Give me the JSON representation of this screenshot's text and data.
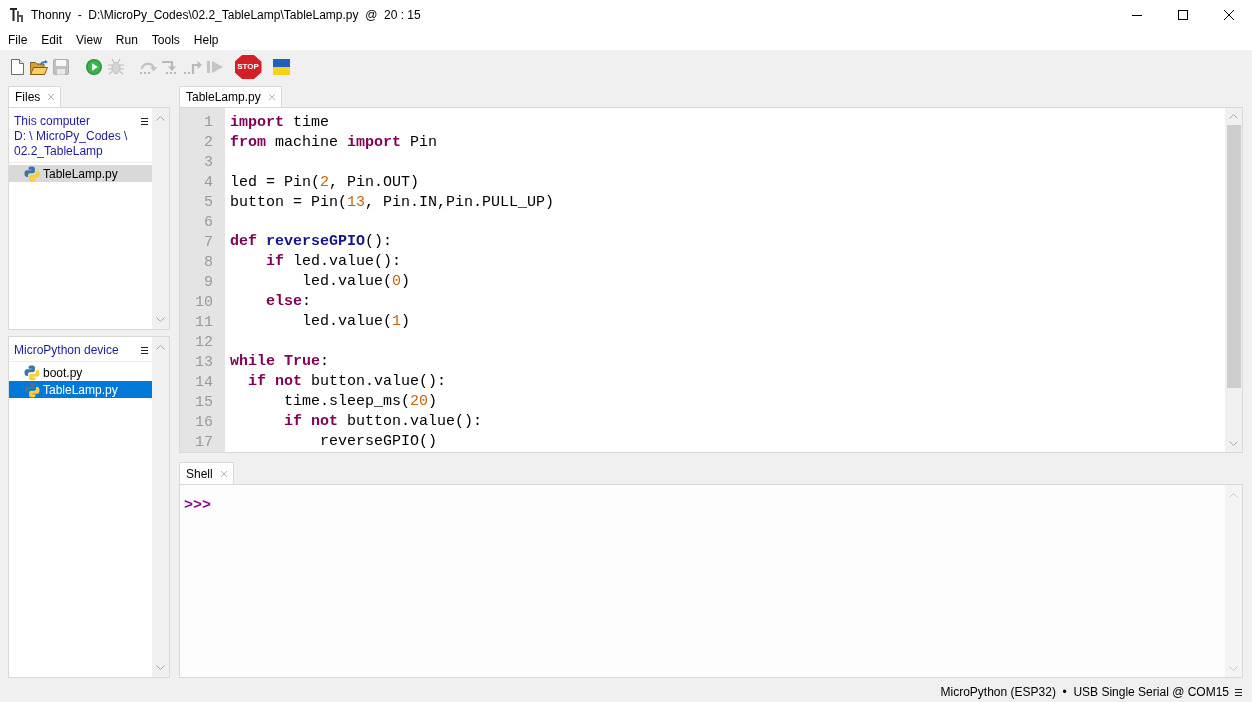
{
  "window": {
    "title": "Thonny  -  D:\\MicroPy_Codes\\02.2_TableLamp\\TableLamp.py  @  20 : 15"
  },
  "menu": [
    "File",
    "Edit",
    "View",
    "Run",
    "Tools",
    "Help"
  ],
  "toolbar": [
    {
      "buttons": [
        {
          "kind": "new",
          "disabled": false
        },
        {
          "kind": "open",
          "disabled": false
        },
        {
          "kind": "save",
          "disabled": true
        }
      ]
    },
    {
      "buttons": [
        {
          "kind": "run",
          "disabled": false
        },
        {
          "kind": "debug",
          "disabled": true
        }
      ]
    },
    {
      "buttons": [
        {
          "kind": "step_over",
          "disabled": true
        },
        {
          "kind": "step_into",
          "disabled": true
        },
        {
          "kind": "step_out",
          "disabled": true
        },
        {
          "kind": "resume",
          "disabled": true
        }
      ]
    },
    {
      "buttons": [
        {
          "kind": "stop",
          "label": "STOP",
          "disabled": false
        }
      ]
    },
    {
      "buttons": [
        {
          "kind": "flag",
          "disabled": false
        }
      ]
    }
  ],
  "files_view": {
    "tab": {
      "label": "Files",
      "selected": true
    },
    "panes": [
      {
        "location": [
          "This computer",
          "D: \\ MicroPy_Codes \\",
          "02.2_TableLamp"
        ],
        "focused": false,
        "items": [
          {
            "name": "TableLamp.py",
            "selected": true
          }
        ]
      },
      {
        "location": [
          "MicroPython device"
        ],
        "focused": true,
        "items": [
          {
            "name": "boot.py",
            "selected": false
          },
          {
            "name": "TableLamp.py",
            "selected": true
          }
        ]
      }
    ]
  },
  "editor": {
    "tabs": [
      {
        "label": "TableLamp.py",
        "selected": true
      }
    ],
    "lines": [
      {
        "number": "1",
        "tokens": [
          {
            "kind": "keyword",
            "text": "import"
          },
          {
            "kind": "plain",
            "text": " time"
          }
        ]
      },
      {
        "number": "2",
        "tokens": [
          {
            "kind": "keyword",
            "text": "from"
          },
          {
            "kind": "plain",
            "text": " machine "
          },
          {
            "kind": "keyword",
            "text": "import"
          },
          {
            "kind": "plain",
            "text": " Pin"
          }
        ]
      },
      {
        "number": "3"
      },
      {
        "number": "4",
        "tokens": [
          {
            "kind": "plain",
            "text": "led = Pin("
          },
          {
            "kind": "number",
            "text": "2"
          },
          {
            "kind": "plain",
            "text": ", Pin.OUT)"
          }
        ]
      },
      {
        "number": "5",
        "tokens": [
          {
            "kind": "plain",
            "text": "button = Pin("
          },
          {
            "kind": "number",
            "text": "13"
          },
          {
            "kind": "plain",
            "text": ", Pin.IN,Pin.PULL_UP)"
          }
        ]
      },
      {
        "number": "6"
      },
      {
        "number": "7",
        "tokens": [
          {
            "kind": "keyword",
            "text": "def"
          },
          {
            "kind": "function",
            "text": " reverseGPIO"
          },
          {
            "kind": "plain",
            "text": "():"
          }
        ]
      },
      {
        "number": "8",
        "tokens": [
          {
            "kind": "keyword",
            "text": "    if"
          },
          {
            "kind": "plain",
            "text": " led.value():"
          }
        ]
      },
      {
        "number": "9",
        "tokens": [
          {
            "kind": "plain",
            "text": "        led.value("
          },
          {
            "kind": "number",
            "text": "0"
          },
          {
            "kind": "plain",
            "text": ")"
          }
        ]
      },
      {
        "number": "10",
        "tokens": [
          {
            "kind": "keyword",
            "text": "    else"
          },
          {
            "kind": "plain",
            "text": ":"
          }
        ]
      },
      {
        "number": "11",
        "tokens": [
          {
            "kind": "plain",
            "text": "        led.value("
          },
          {
            "kind": "number",
            "text": "1"
          },
          {
            "kind": "plain",
            "text": ")"
          }
        ]
      },
      {
        "number": "12"
      },
      {
        "number": "13",
        "tokens": [
          {
            "kind": "keyword",
            "text": "while"
          },
          {
            "kind": "keyword",
            "text": " True"
          },
          {
            "kind": "plain",
            "text": ":"
          }
        ]
      },
      {
        "number": "14",
        "tokens": [
          {
            "kind": "keyword",
            "text": "  if"
          },
          {
            "kind": "keyword",
            "text": " not"
          },
          {
            "kind": "plain",
            "text": " button.value():"
          }
        ]
      },
      {
        "number": "15",
        "tokens": [
          {
            "kind": "plain",
            "text": "      time.sleep_ms("
          },
          {
            "kind": "number",
            "text": "20"
          },
          {
            "kind": "plain",
            "text": ")"
          }
        ]
      },
      {
        "number": "16",
        "tokens": [
          {
            "kind": "keyword",
            "text": "      if"
          },
          {
            "kind": "keyword",
            "text": " not"
          },
          {
            "kind": "plain",
            "text": " button.value():"
          }
        ]
      },
      {
        "number": "17",
        "tokens": [
          {
            "kind": "plain",
            "text": "          reverseGPIO()"
          }
        ]
      }
    ]
  },
  "shell": {
    "tab": {
      "label": "Shell",
      "selected": true
    },
    "lines": [
      {
        "kind": "prompt",
        "text": ">>>"
      }
    ]
  },
  "status_bar": {
    "connection": "MicroPython (ESP32)  •  USB Single Serial @ COM15"
  }
}
